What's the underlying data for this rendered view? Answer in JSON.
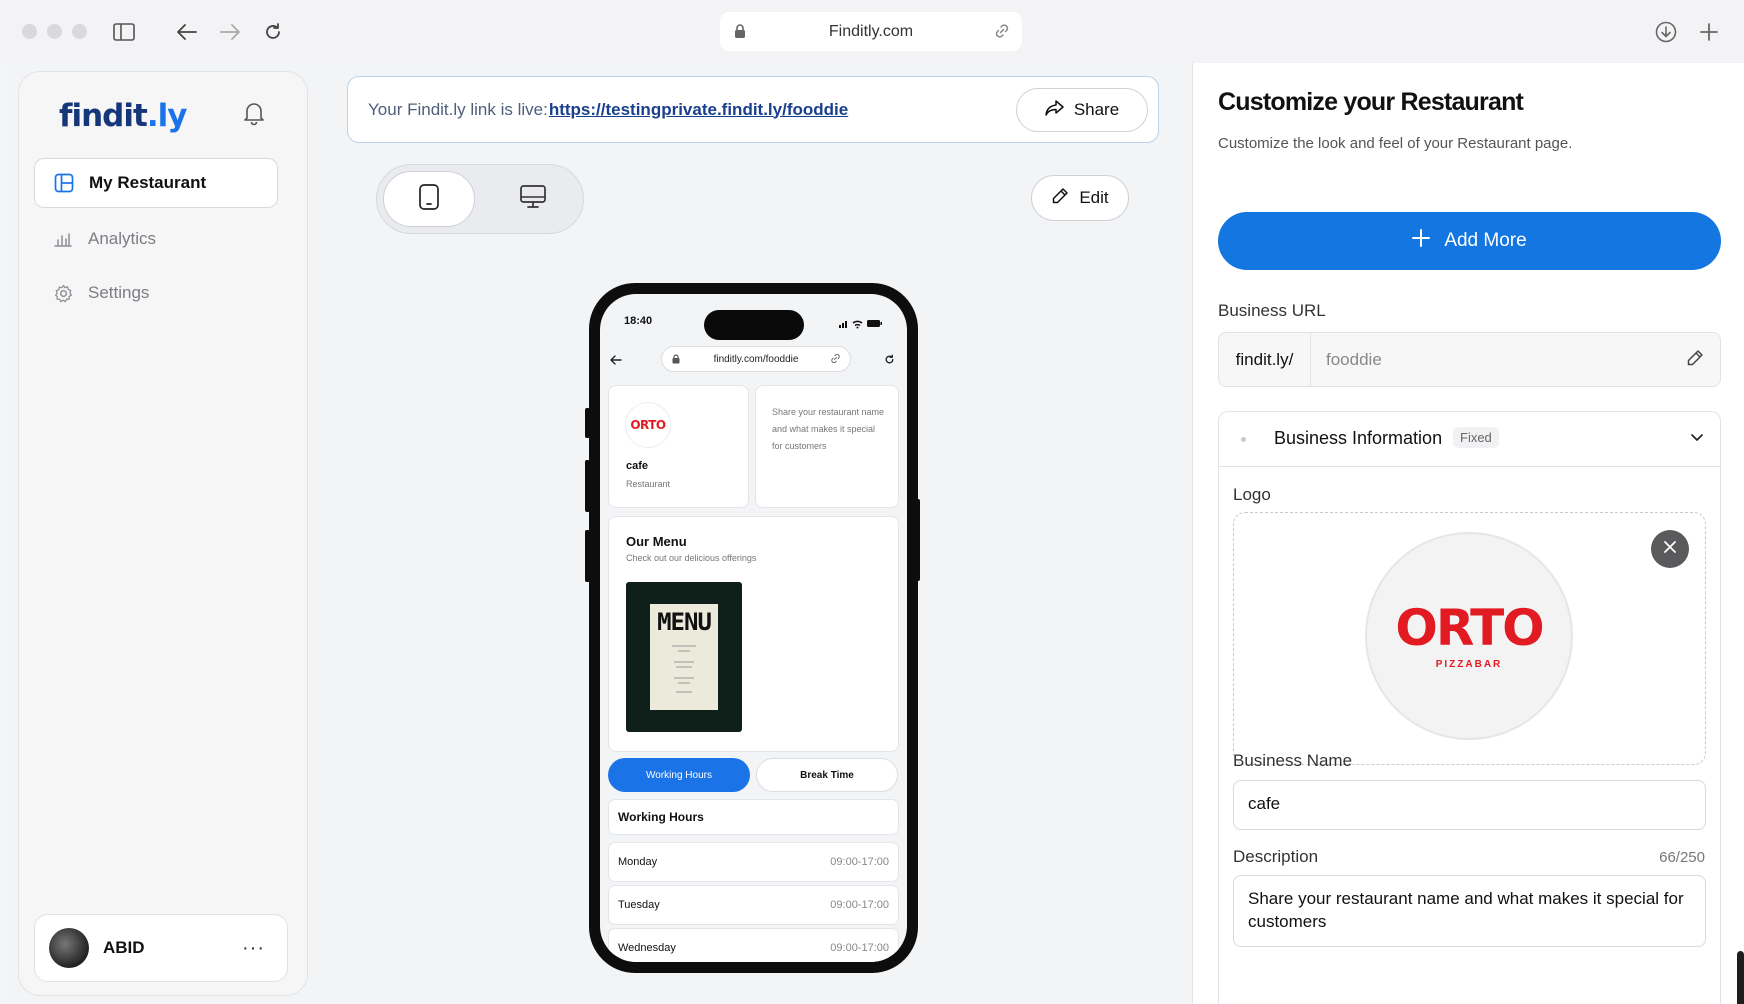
{
  "browser": {
    "url": "Finditly.com"
  },
  "sidebar": {
    "logo_text_main": "findit",
    "logo_text_dot": ".",
    "logo_text_tail": "ly",
    "items": [
      {
        "label": "My Restaurant",
        "icon": "layout-icon",
        "active": true
      },
      {
        "label": "Analytics",
        "icon": "bar-chart-icon",
        "active": false
      },
      {
        "label": "Settings",
        "icon": "gear-icon",
        "active": false
      }
    ],
    "user": {
      "name": "ABID",
      "menu": "···"
    }
  },
  "banner": {
    "prefix": "Your Findit.ly link is live:",
    "link": "https://testingprivate.findit.ly/fooddie",
    "share_label": "Share"
  },
  "toolbar": {
    "edit_label": "Edit"
  },
  "phone": {
    "time": "18:40",
    "url": "finditly.com/fooddie",
    "profile": {
      "logo_text": "ORTO",
      "name": "cafe",
      "type": "Restaurant",
      "description": "Share your restaurant name and what makes it special for customers"
    },
    "menu": {
      "title": "Our Menu",
      "subtitle": "Check out our delicious offerings",
      "image_text": "MENU"
    },
    "tabs": [
      "Working Hours",
      "Break Time"
    ],
    "hours_heading": "Working Hours",
    "hours": [
      {
        "day": "Monday",
        "time": "09:00-17:00"
      },
      {
        "day": "Tuesday",
        "time": "09:00-17:00"
      },
      {
        "day": "Wednesday",
        "time": "09:00-17:00"
      }
    ]
  },
  "panel": {
    "title": "Customize your Restaurant",
    "subtitle": "Customize the look and feel of your Restaurant page.",
    "add_more_label": "Add More",
    "business_url_label": "Business URL",
    "url_prefix": "findit.ly/",
    "url_value": "fooddie",
    "section_title": "Business Information",
    "section_badge": "Fixed",
    "logo_label": "Logo",
    "logo": {
      "text": "ORTO",
      "subtext": "PIZZABAR"
    },
    "business_name_label": "Business Name",
    "business_name_value": "cafe",
    "description_label": "Description",
    "description_counter": "66/250",
    "description_value": "Share your restaurant name and what makes it special for customers"
  },
  "colors": {
    "accent": "#1476e0",
    "brand_red": "#e21b23",
    "logo_navy": "#16367a"
  }
}
